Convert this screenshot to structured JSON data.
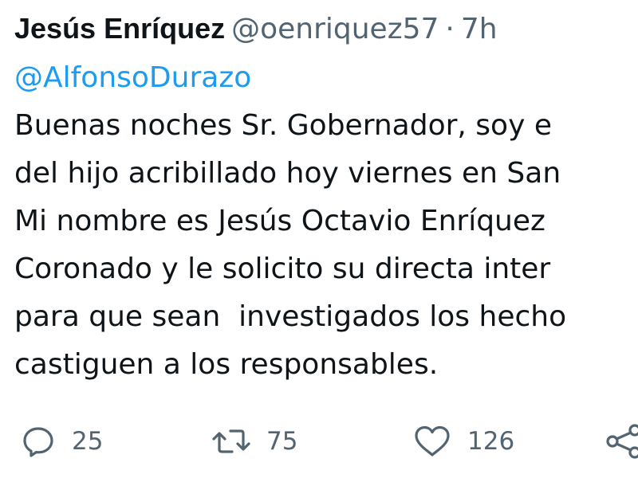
{
  "tweet": {
    "author": {
      "display_name": "Jesús Enríquez",
      "handle": "@oenriquez57",
      "separator": "·",
      "timestamp": "7h"
    },
    "mention": "@AlfonsoDurazo",
    "body_lines": [
      "Buenas noches Sr. Gobernador, soy e",
      "del hijo acribillado hoy viernes en San",
      "Mi nombre es Jesús Octavio Enríquez",
      "Coronado y le solicito su directa inter",
      "para que sean  investigados los hecho",
      "castiguen a los responsables."
    ]
  },
  "actions": {
    "reply": {
      "icon": "reply-icon",
      "count": "25"
    },
    "retweet": {
      "icon": "retweet-icon",
      "count": "75"
    },
    "like": {
      "icon": "heart-icon",
      "count": "126"
    },
    "share": {
      "icon": "share-icon"
    }
  },
  "colors": {
    "text_primary": "#0f1419",
    "text_secondary": "#536471",
    "link": "#1d9bf0",
    "background": "#ffffff"
  }
}
